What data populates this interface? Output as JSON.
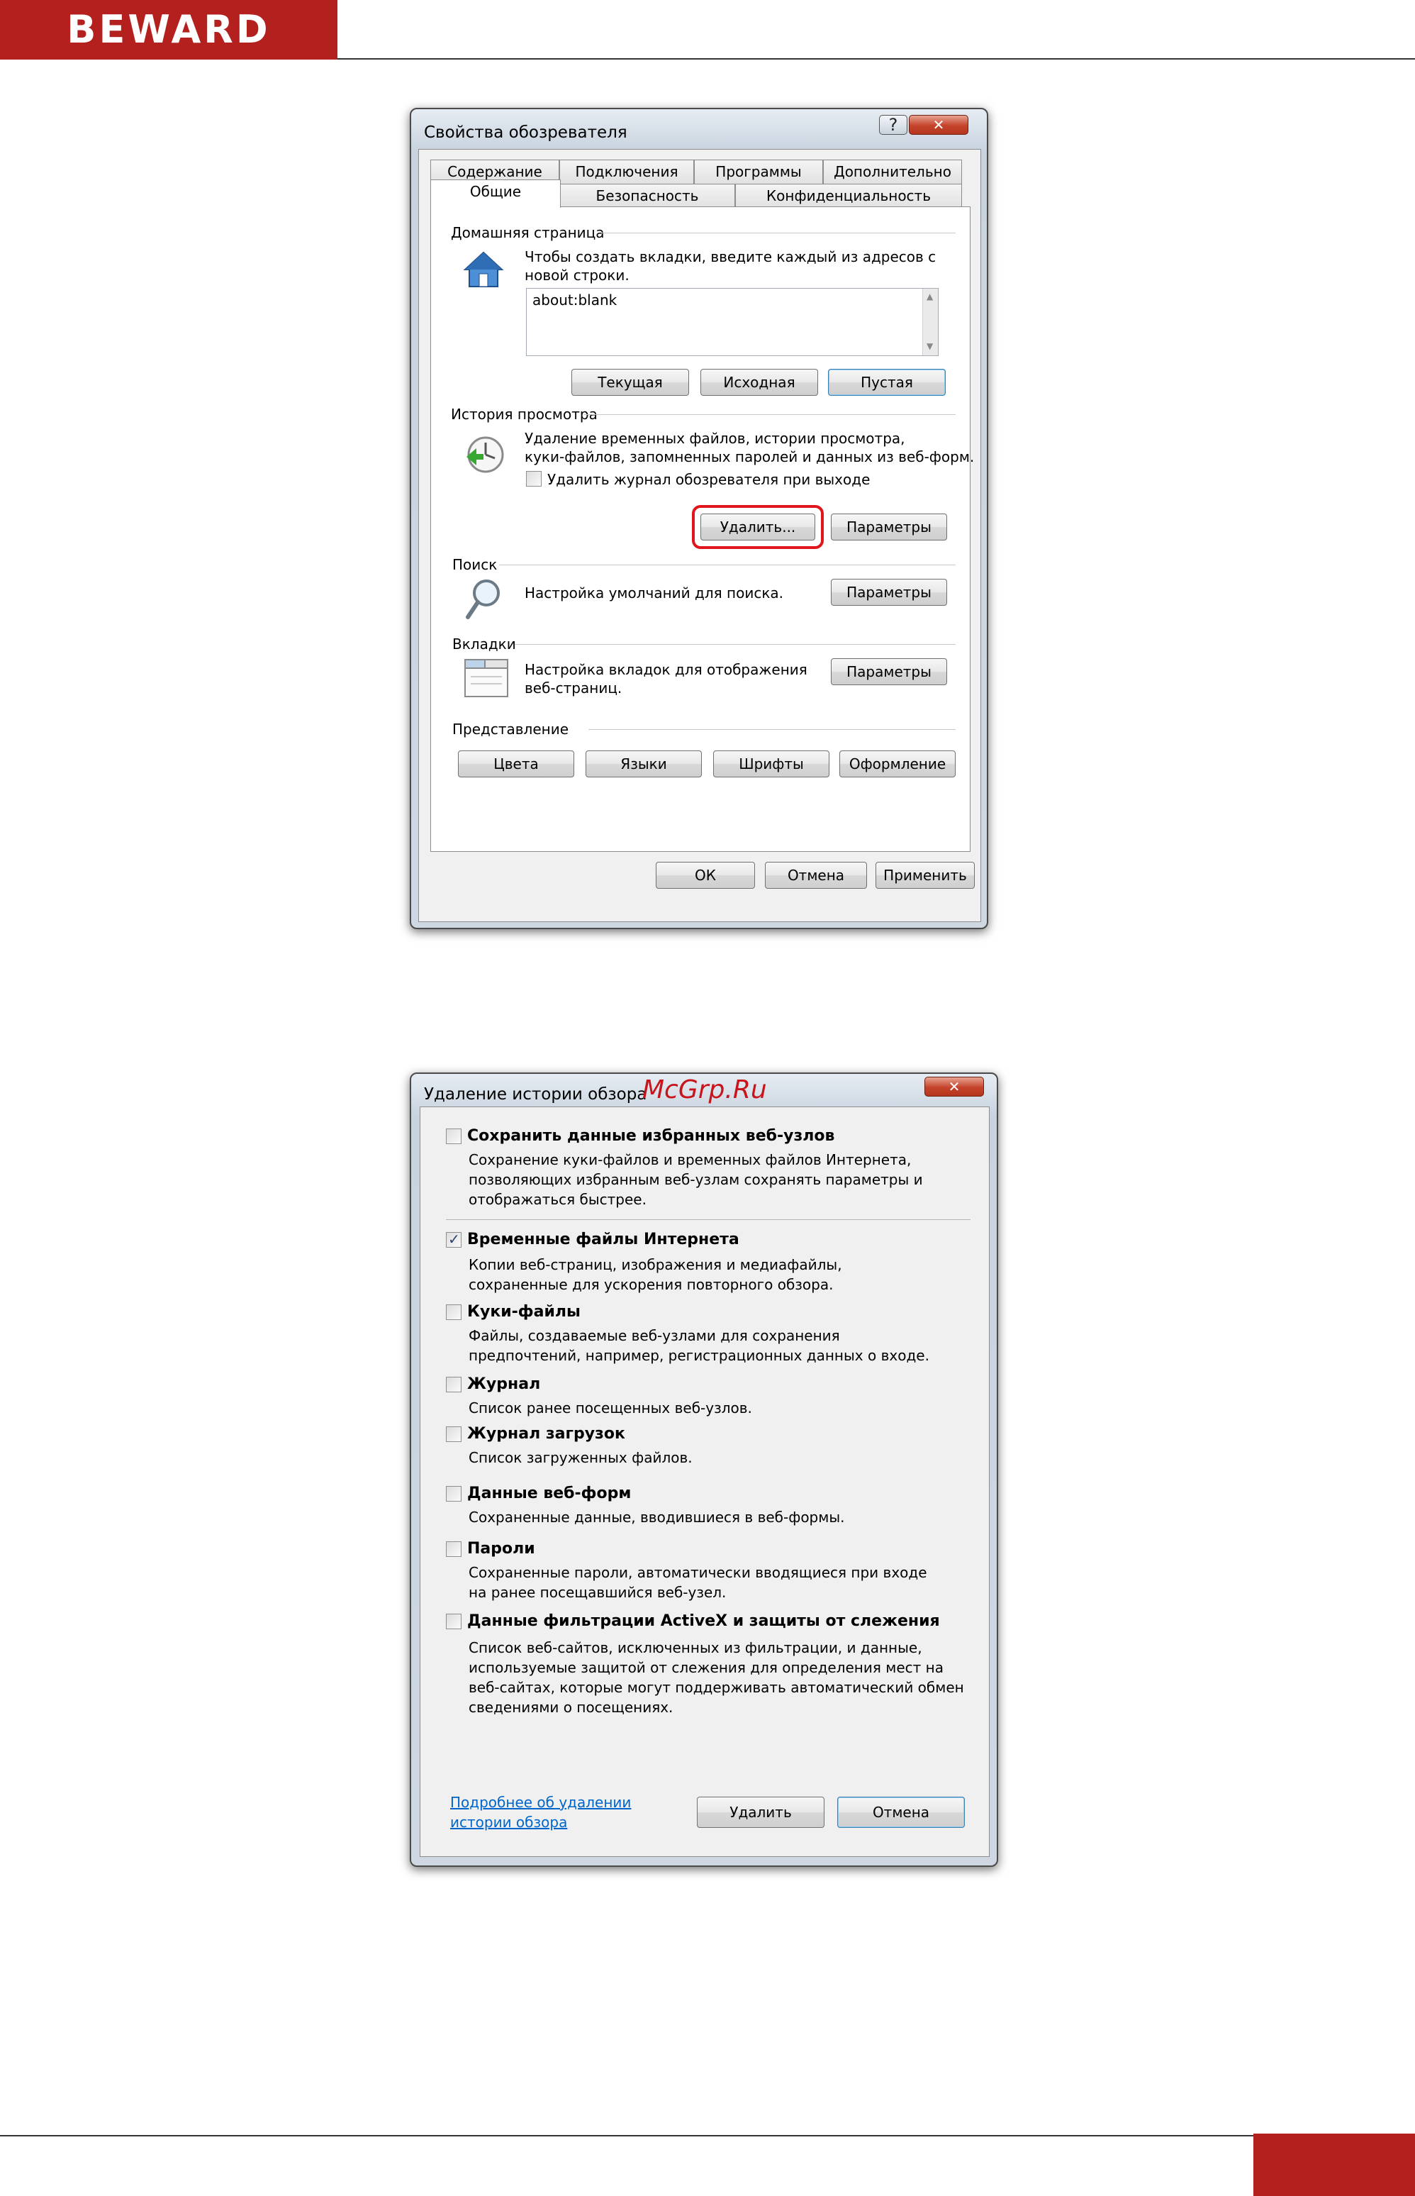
{
  "header": {
    "logo_text": "BEWARD",
    "brand_color": "#b3201e"
  },
  "dialog1": {
    "title": "Свойства обозревателя",
    "help_label": "?",
    "close_label": "✕",
    "tabs_row1": [
      "Содержание",
      "Подключения",
      "Программы",
      "Дополнительно"
    ],
    "tabs_row2": [
      "Общие",
      "Безопасность",
      "Конфиденциальность"
    ],
    "home": {
      "group": "Домашняя страница",
      "text": [
        "Чтобы создать вкладки, введите каждый из адресов с",
        "новой строки."
      ],
      "address": "about:blank",
      "btn_current": "Текущая",
      "btn_default": "Исходная",
      "btn_blank": "Пустая"
    },
    "history": {
      "group": "История просмотра",
      "text": [
        "Удаление временных файлов, истории просмотра,",
        "куки-файлов, запомненных паролей и данных из веб-форм."
      ],
      "checkbox_label": "Удалить журнал обозревателя при выходе",
      "btn_delete": "Удалить...",
      "btn_settings": "Параметры"
    },
    "search": {
      "group": "Поиск",
      "text": "Настройка умолчаний для поиска.",
      "btn_settings": "Параметры"
    },
    "tabs_group": {
      "group": "Вкладки",
      "text": [
        "Настройка вкладок для отображения",
        "веб-страниц."
      ],
      "btn_settings": "Параметры"
    },
    "appearance": {
      "group": "Представление",
      "btn_colors": "Цвета",
      "btn_languages": "Языки",
      "btn_fonts": "Шрифты",
      "btn_accessibility": "Оформление"
    },
    "footer": {
      "ok": "ОК",
      "cancel": "Отмена",
      "apply": "Применить"
    }
  },
  "dialog2": {
    "title": "Удаление истории обзора",
    "watermark": "McGrp.Ru",
    "close_label": "✕",
    "items": [
      {
        "label": "Сохранить данные избранных веб-узлов",
        "checked": false,
        "desc": [
          "Сохранение куки-файлов и временных файлов Интернета,",
          "позволяющих избранным веб-узлам сохранять параметры и",
          "отображаться быстрее."
        ]
      },
      {
        "label": "Временные файлы Интернета",
        "checked": true,
        "desc": [
          "Копии веб-страниц, изображения и медиафайлы,",
          "сохраненные для ускорения повторного обзора."
        ]
      },
      {
        "label": "Куки-файлы",
        "checked": false,
        "desc": [
          "Файлы, создаваемые веб-узлами для сохранения",
          "предпочтений, например, регистрационных данных о входе."
        ]
      },
      {
        "label": "Журнал",
        "checked": false,
        "desc": [
          "Список ранее посещенных веб-узлов."
        ]
      },
      {
        "label": "Журнал загрузок",
        "checked": false,
        "desc": [
          "Список загруженных файлов."
        ]
      },
      {
        "label": "Данные веб-форм",
        "checked": false,
        "desc": [
          "Сохраненные данные, вводившиеся в веб-формы."
        ]
      },
      {
        "label": "Пароли",
        "checked": false,
        "desc": [
          "Сохраненные пароли, автоматически вводящиеся при входе",
          "на ранее посещавшийся веб-узел."
        ]
      },
      {
        "label": "Данные фильтрации ActiveX и защиты от слежения",
        "checked": false,
        "desc": [
          "Список веб-сайтов, исключенных из фильтрации, и данные,",
          "используемые защитой от слежения для определения мест на",
          "веб-сайтах, которые могут поддерживать автоматический обмен",
          "сведениями о посещениях."
        ]
      }
    ],
    "link": [
      "Подробнее об удалении",
      "истории обзора"
    ],
    "btn_delete": "Удалить",
    "btn_cancel": "Отмена"
  }
}
